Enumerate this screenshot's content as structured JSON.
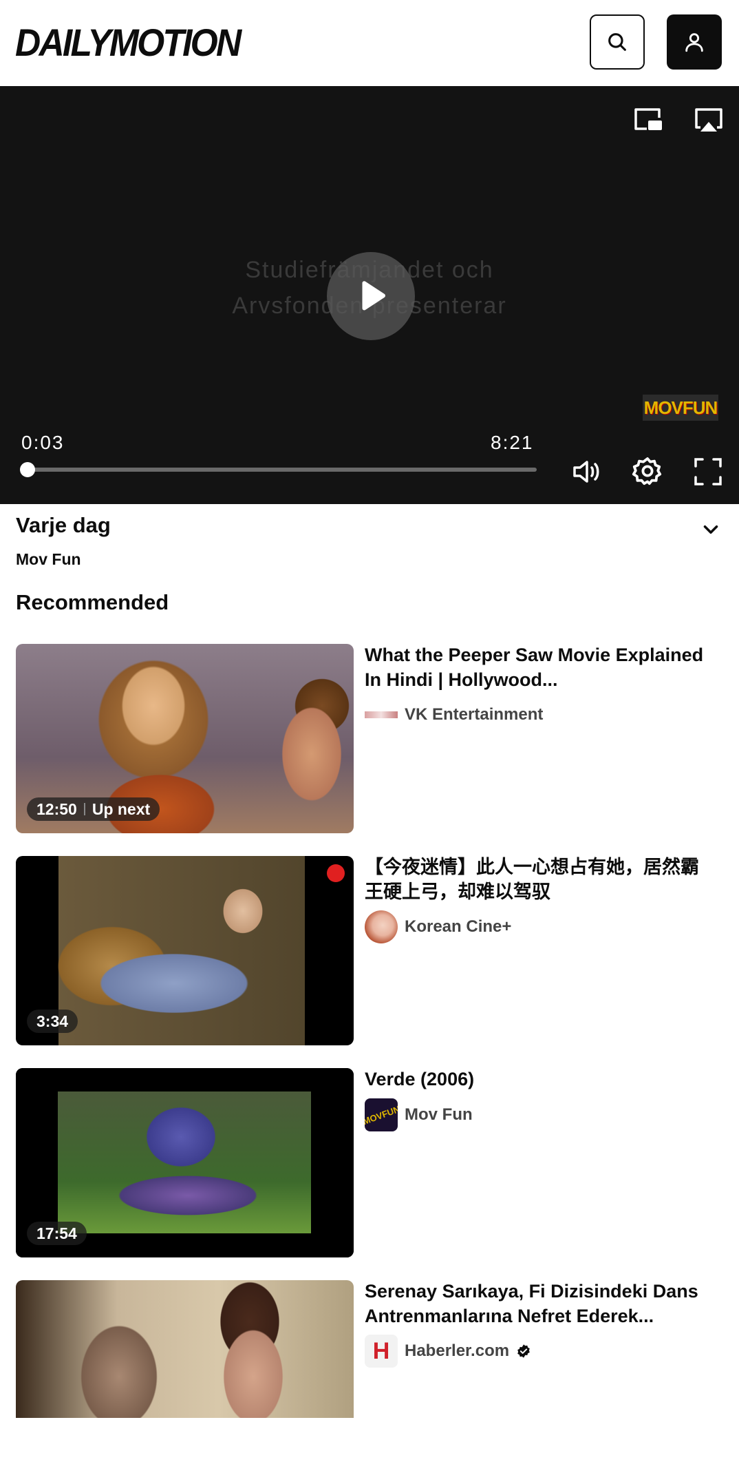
{
  "header": {
    "logo": "DAILYMOTION",
    "search_icon": "search-icon",
    "account_icon": "user-icon"
  },
  "player": {
    "overlay_line1": "Studiefrämjandet och",
    "overlay_line2": "Arvsfonden presenterar",
    "current_time": "0:03",
    "duration": "8:21",
    "progress_fraction": 0.006,
    "watermark": "MOVFUN",
    "icons": [
      "picture-in-picture-icon",
      "airplay-icon",
      "play-icon",
      "volume-icon",
      "settings-icon",
      "fullscreen-icon"
    ]
  },
  "video": {
    "title": "Varje dag",
    "channel": "Mov Fun"
  },
  "recommended": {
    "heading": "Recommended",
    "items": [
      {
        "title": "What the Peeper Saw Movie Explained In Hindi | Hollywood...",
        "channel": "VK Entertainment",
        "duration": "12:50",
        "badge_extra": "Up next",
        "verified": false
      },
      {
        "title": "【今夜迷情】此人一心想占有她，居然霸王硬上弓，却难以驾驭",
        "channel": "Korean Cine+",
        "duration": "3:34",
        "badge_extra": "",
        "verified": false
      },
      {
        "title": "Verde (2006)",
        "channel": "Mov Fun",
        "duration": "17:54",
        "badge_extra": "",
        "verified": false
      },
      {
        "title": "Serenay Sarıkaya, Fi Dizisindeki Dans Antrenmanlarına Nefret Ederek...",
        "channel": "Haberler.com",
        "duration": "",
        "badge_extra": "",
        "verified": true
      }
    ]
  },
  "colors": {
    "player_bg": "#131313",
    "text_primary": "#0d0d0d",
    "text_secondary": "#444444"
  }
}
